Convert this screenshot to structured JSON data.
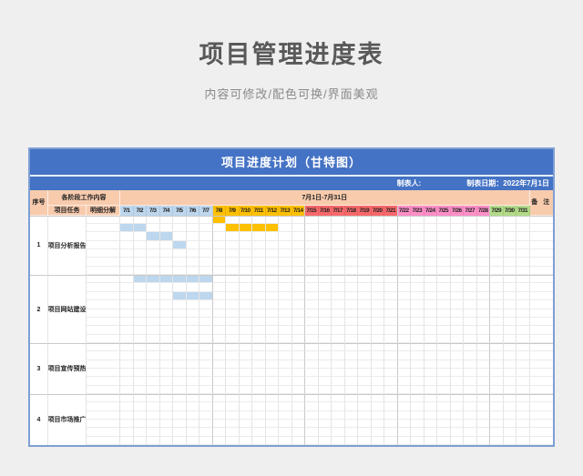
{
  "page": {
    "title": "项目管理进度表",
    "subtitle": "内容可修改/配色可换/界面美观"
  },
  "sheet": {
    "title": "项目进度计划（甘特图）",
    "maker_label": "制表人:",
    "date_label": "制表日期：2022年7月1日",
    "headers": {
      "serial": "序号",
      "stage": "各阶段工作内容",
      "task": "项目任务",
      "detail": "明细分解",
      "date_range": "7月1日-7月31日",
      "remark": "备 注"
    }
  },
  "colors": {
    "accent_blue": "#4472c4",
    "card_border": "#7c9fd4",
    "header_peach": "#f8cbad",
    "bar_blue": "#bdd7ee",
    "bar_gold": "#ffc000",
    "page_bg": "#efefef",
    "title_gray": "#595959"
  },
  "chart_data": {
    "type": "table",
    "variant": "gantt",
    "title": "项目进度计划（甘特图）",
    "date_range_label": "7月1日-7月31日",
    "days": [
      "7/1",
      "7/2",
      "7/3",
      "7/4",
      "7/5",
      "7/6",
      "7/7",
      "7/8",
      "7/9",
      "7/10",
      "7/11",
      "7/12",
      "7/13",
      "7/14",
      "7/15",
      "7/16",
      "7/17",
      "7/18",
      "7/19",
      "7/20",
      "7/21",
      "7/22",
      "7/23",
      "7/24",
      "7/25",
      "7/26",
      "7/27",
      "7/28",
      "7/29",
      "7/30",
      "7/31"
    ],
    "week_colors": [
      {
        "days": "7/1-7/7",
        "color": "#bdd7ee"
      },
      {
        "days": "7/8-7/14",
        "color": "#ffc000"
      },
      {
        "days": "7/15-7/21",
        "color": "#f8696b"
      },
      {
        "days": "7/22-7/28",
        "color": "#ff8fc8"
      },
      {
        "days": "7/29-7/31",
        "color": "#b2db87"
      }
    ],
    "sections": [
      {
        "no": "1",
        "task": "项目分析报告",
        "rows": 7,
        "bars": [
          {
            "row": 0,
            "start": 8,
            "end": 8,
            "color": "#ffc000"
          },
          {
            "row": 1,
            "start": 1,
            "end": 2,
            "color": "#bdd7ee"
          },
          {
            "row": 1,
            "start": 9,
            "end": 12,
            "color": "#ffc000"
          },
          {
            "row": 2,
            "start": 3,
            "end": 4,
            "color": "#bdd7ee"
          },
          {
            "row": 3,
            "start": 5,
            "end": 5,
            "color": "#bdd7ee"
          }
        ]
      },
      {
        "no": "2",
        "task": "项目网站建设",
        "rows": 8,
        "bars": [
          {
            "row": 0,
            "start": 2,
            "end": 7,
            "color": "#bdd7ee"
          },
          {
            "row": 2,
            "start": 5,
            "end": 7,
            "color": "#bdd7ee"
          }
        ]
      },
      {
        "no": "3",
        "task": "项目宣传预热",
        "rows": 6,
        "bars": []
      },
      {
        "no": "4",
        "task": "项目市场推广",
        "rows": 6,
        "bars": []
      }
    ]
  }
}
